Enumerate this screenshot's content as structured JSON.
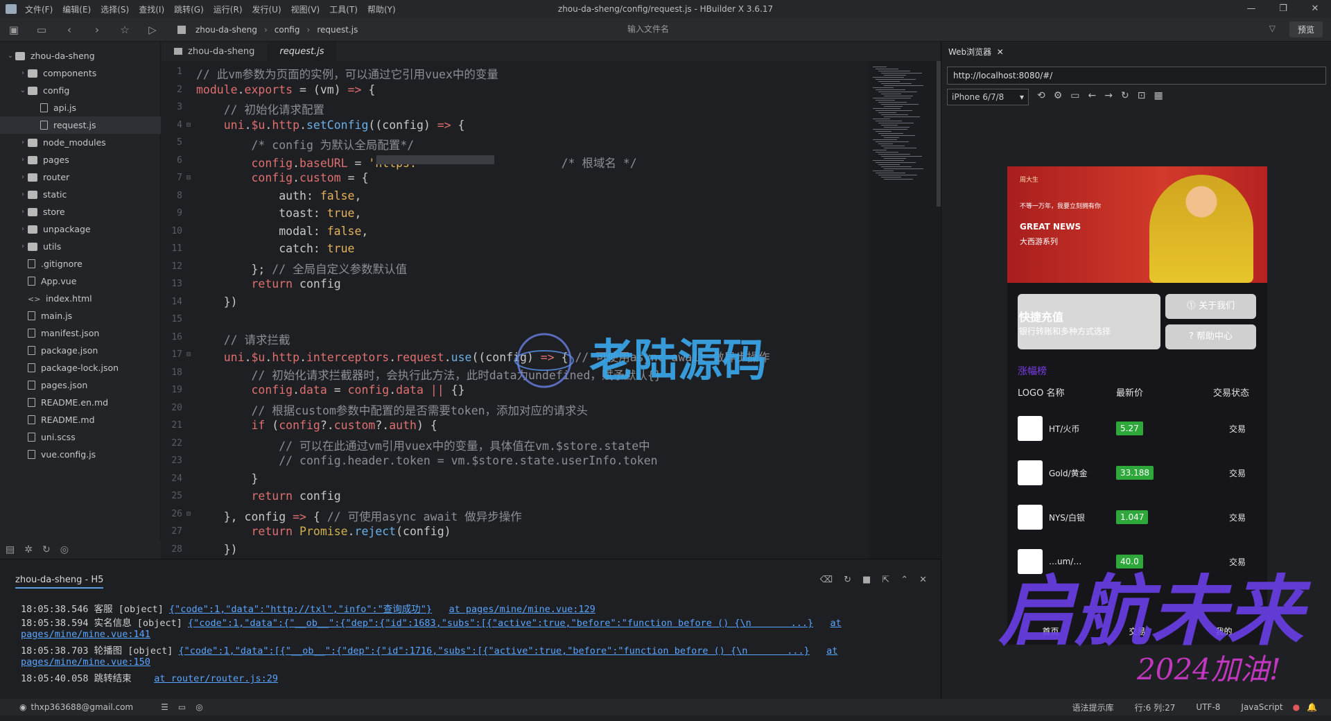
{
  "menubar": {
    "items": [
      "文件(F)",
      "编辑(E)",
      "选择(S)",
      "查找(I)",
      "跳转(G)",
      "运行(R)",
      "发行(U)",
      "视图(V)",
      "工具(T)",
      "帮助(Y)"
    ],
    "window_title": "zhou-da-sheng/config/request.js - HBuilder X 3.6.17"
  },
  "toolbar": {
    "breadcrumb": [
      "zhou-da-sheng",
      "config",
      "request.js"
    ],
    "file_search_placeholder": "输入文件名",
    "preview_label": "预览"
  },
  "sidebar": {
    "items": [
      {
        "label": "zhou-da-sheng",
        "kind": "folder",
        "depth": 0,
        "open": true
      },
      {
        "label": "components",
        "kind": "folder",
        "depth": 1
      },
      {
        "label": "config",
        "kind": "folder",
        "depth": 1,
        "open": true
      },
      {
        "label": "api.js",
        "kind": "file",
        "depth": 2
      },
      {
        "label": "request.js",
        "kind": "file",
        "depth": 2,
        "selected": true
      },
      {
        "label": "node_modules",
        "kind": "folder",
        "depth": 1
      },
      {
        "label": "pages",
        "kind": "folder",
        "depth": 1
      },
      {
        "label": "router",
        "kind": "folder",
        "depth": 1
      },
      {
        "label": "static",
        "kind": "folder",
        "depth": 1
      },
      {
        "label": "store",
        "kind": "folder",
        "depth": 1
      },
      {
        "label": "unpackage",
        "kind": "folder",
        "depth": 1
      },
      {
        "label": "utils",
        "kind": "folder",
        "depth": 1
      },
      {
        "label": ".gitignore",
        "kind": "file",
        "depth": 1
      },
      {
        "label": "App.vue",
        "kind": "file",
        "depth": 1
      },
      {
        "label": "index.html",
        "kind": "code",
        "depth": 1
      },
      {
        "label": "main.js",
        "kind": "file",
        "depth": 1
      },
      {
        "label": "manifest.json",
        "kind": "file",
        "depth": 1
      },
      {
        "label": "package.json",
        "kind": "file",
        "depth": 1
      },
      {
        "label": "package-lock.json",
        "kind": "file",
        "depth": 1
      },
      {
        "label": "pages.json",
        "kind": "file",
        "depth": 1
      },
      {
        "label": "README.en.md",
        "kind": "file",
        "depth": 1
      },
      {
        "label": "README.md",
        "kind": "file",
        "depth": 1
      },
      {
        "label": "uni.scss",
        "kind": "file",
        "depth": 1
      },
      {
        "label": "vue.config.js",
        "kind": "file",
        "depth": 1
      }
    ]
  },
  "tabs": [
    "zhou-da-sheng",
    "request.js"
  ],
  "editor": {
    "lines": [
      "<span class=\"c\">// 此vm参数为页面的实例，可以通过它引用vuex中的变量</span>",
      "<span class=\"k\">module</span>.<span class=\"k\">exports</span> = (vm) <span class=\"k\">=&gt;</span> {",
      "    <span class=\"c\">// 初始化请求配置</span>",
      "    <span class=\"k\">uni</span>.<span class=\"k\">$u</span>.<span class=\"k\">http</span>.<span class=\"f\">setConfig</span>((config) <span class=\"k\">=&gt;</span> {",
      "        <span class=\"c\">/* config 为默认全局配置*/</span>",
      "        <span class=\"k\">config</span>.<span class=\"k\">baseURL</span> = <span class=\"s\">'https:</span>                     <span class=\"c\">/* 根域名 */</span>",
      "        <span class=\"k\">config</span>.<span class=\"k\">custom</span> = {",
      "            auth: <span class=\"b\">false</span>,",
      "            toast: <span class=\"b\">true</span>,",
      "            modal: <span class=\"b\">false</span>,",
      "            catch: <span class=\"b\">true</span>",
      "        }; <span class=\"c\">// 全局自定义参数默认值</span>",
      "        <span class=\"k\">return</span> config",
      "    })",
      "",
      "    <span class=\"c\">// 请求拦截</span>",
      "    <span class=\"k\">uni</span>.<span class=\"k\">$u</span>.<span class=\"k\">http</span>.<span class=\"k\">interceptors</span>.<span class=\"k\">request</span>.<span class=\"f\">use</span>((config) <span class=\"k\">=&gt;</span> { <span class=\"c\">// 可使用async await 做异步操作</span>",
      "        <span class=\"c\">// 初始化请求拦截器时，会执行此方法，此时data为undefined，赋予默认{}</span>",
      "        <span class=\"k\">config</span>.<span class=\"k\">data</span> = <span class=\"k\">config</span>.<span class=\"k\">data</span> <span class=\"k\">||</span> {}",
      "        <span class=\"c\">// 根据custom参数中配置的是否需要token，添加对应的请求头</span>",
      "        <span class=\"k\">if</span> (<span class=\"k\">config</span>?.<span class=\"k\">custom</span>?.<span class=\"k\">auth</span>) {",
      "            <span class=\"c\">// 可以在此通过vm引用vuex中的变量，具体值在vm.$store.state中</span>",
      "            <span class=\"c\">// config.header.token = vm.$store.state.userInfo.token</span>",
      "        }",
      "        <span class=\"k\">return</span> config",
      "    }, config <span class=\"k\">=&gt;</span> { <span class=\"c\">// 可使用async await 做异步操作</span>",
      "        <span class=\"k\">return</span> <span class=\"p\">Promise</span>.<span class=\"f\">reject</span>(config)",
      "    })"
    ],
    "folds": [
      4,
      7,
      17,
      26
    ]
  },
  "console": {
    "tab": "zhou-da-sheng - H5",
    "logs": [
      {
        "time": "18:05:38.546",
        "text": " 客服 [object] ",
        "data": "{\"code\":1,\"data\":\"http://txl\",\"info\":\"查询成功\"}",
        "at": "at pages/mine/mine.vue:129"
      },
      {
        "time": "18:05:38.594",
        "text": " 实名信息 [object] ",
        "data": "{\"code\":1,\"data\":{\"__ob__\":{\"dep\":{\"id\":1683,\"subs\":[{\"active\":true,\"before\":\"function before () {\\n       ...}",
        "at": "at",
        "at2": "pages/mine/mine.vue:141"
      },
      {
        "time": "18:05:38.703",
        "text": " 轮播图 [object] ",
        "data": "{\"code\":1,\"data\":[{\"__ob__\":{\"dep\":{\"id\":1716,\"subs\":[{\"active\":true,\"before\":\"function before () {\\n       ...}",
        "at": "at",
        "at2": "pages/mine/mine.vue:150"
      },
      {
        "time": "18:05:40.058",
        "text": " 跳转结束 ",
        "data": "",
        "at": "at router/router.js:29"
      }
    ]
  },
  "statusbar": {
    "email": "thxp363688@gmail.com",
    "hint": "语法提示库",
    "position": "行:6  列:27",
    "encoding": "UTF-8",
    "language": "JavaScript"
  },
  "browser": {
    "tab": "Web浏览器",
    "url": "http://localhost:8080/#/",
    "device": "iPhone 6/7/8",
    "banner": {
      "brand": "周大生",
      "top": "不等一万年，我要立刻拥有你",
      "headline": "GREAT NEWS",
      "sub": "大西游系列"
    },
    "recharge": {
      "title": "快捷充值",
      "desc": "银行转账和多种方式选择"
    },
    "about": "关于我们",
    "help": "帮助中心",
    "rank_title": "涨幅榜",
    "table_head": [
      "LOGO 名称",
      "最新价",
      "交易状态"
    ],
    "rows": [
      {
        "name": "HT/火币",
        "price": "5.27",
        "status": "交易"
      },
      {
        "name": "Gold/黄金",
        "price": "33.188",
        "status": "交易"
      },
      {
        "name": "NYS/白银",
        "price": "1.047",
        "status": "交易"
      },
      {
        "name": "…um/…",
        "price": "40.0",
        "status": "交易"
      }
    ],
    "nav": [
      "首页",
      "交易",
      "我的"
    ]
  },
  "watermark": {
    "center": "老陆源码",
    "corner": "启航未来",
    "year": "2024加油!"
  }
}
